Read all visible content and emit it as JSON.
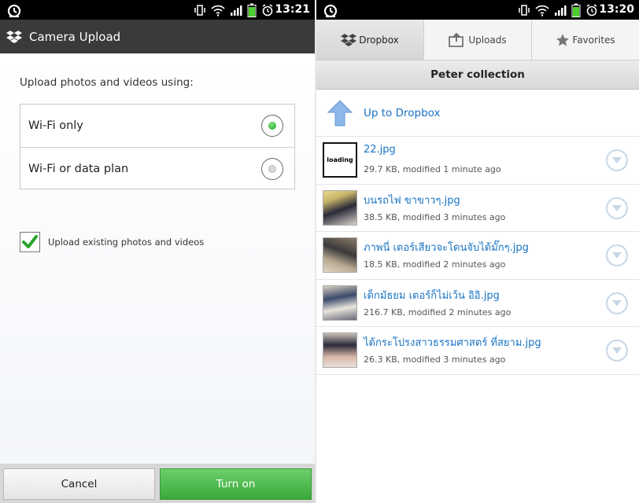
{
  "left": {
    "status_time": "13:21",
    "title": "Camera Upload",
    "prompt": "Upload photos and videos using:",
    "options": [
      {
        "label": "Wi-Fi only",
        "selected": true
      },
      {
        "label": "Wi-Fi or data plan",
        "selected": false
      }
    ],
    "checkbox": {
      "label": "Upload existing photos and videos",
      "checked": true
    },
    "buttons": {
      "cancel": "Cancel",
      "turn_on": "Turn on"
    }
  },
  "right": {
    "status_time": "13:20",
    "tabs": [
      {
        "label": "Dropbox",
        "icon": "dropbox-icon",
        "active": true
      },
      {
        "label": "Uploads",
        "icon": "upload-icon",
        "active": false
      },
      {
        "label": "Favorites",
        "icon": "star-icon",
        "active": false
      }
    ],
    "folder_title": "Peter collection",
    "up_link": "Up to Dropbox",
    "thumb_loading_text": "loading",
    "files": [
      {
        "name": "22.jpg",
        "meta": "29.7 KB, modified 1 minute ago"
      },
      {
        "name": "บนรถไฟ ขาขาวๆ.jpg",
        "meta": "38.5 KB, modified 3 minutes ago"
      },
      {
        "name": "ภาพนี่ เตอร์เสียวจะโดนจับได้มั๊กๆ.jpg",
        "meta": "18.5 KB, modified 2 minutes ago"
      },
      {
        "name": "เด็กมัธยม เตอร์ก็ไม่เว้น อิอิ.jpg",
        "meta": "216.7 KB, modified 2 minutes ago"
      },
      {
        "name": "ได้กระโปรงสาวธรรมศาสตร์ ที่สยาม.jpg",
        "meta": "26.3 KB, modified 3 minutes ago"
      }
    ]
  },
  "colors": {
    "link": "#1a74c4",
    "accent_green": "#3aa83a",
    "titlebar": "#3a3a3a"
  }
}
